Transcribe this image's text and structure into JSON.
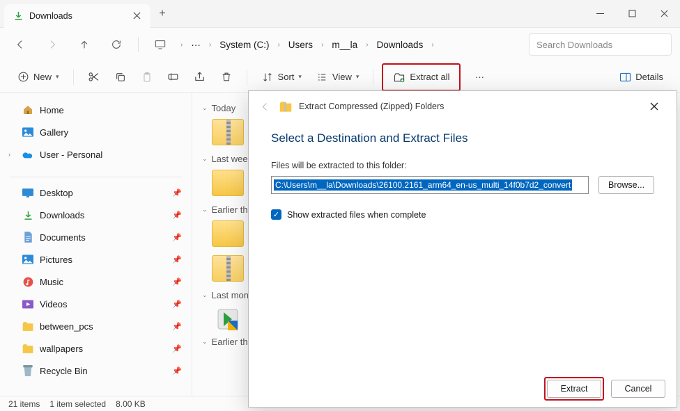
{
  "tab": {
    "title": "Downloads"
  },
  "window_buttons": {
    "min": "minimize",
    "max": "maximize",
    "close": "close"
  },
  "breadcrumbs": {
    "items": [
      "System (C:)",
      "Users",
      "m__la",
      "Downloads"
    ]
  },
  "search": {
    "placeholder": "Search Downloads"
  },
  "toolbar": {
    "new": "New",
    "sort": "Sort",
    "view": "View",
    "extract_all": "Extract all",
    "details": "Details"
  },
  "sidebar": {
    "top": [
      {
        "label": "Home"
      },
      {
        "label": "Gallery"
      },
      {
        "label": "User - Personal",
        "expandable": true
      }
    ],
    "pinned": [
      {
        "label": "Desktop"
      },
      {
        "label": "Downloads"
      },
      {
        "label": "Documents"
      },
      {
        "label": "Pictures"
      },
      {
        "label": "Music"
      },
      {
        "label": "Videos"
      },
      {
        "label": "between_pcs"
      },
      {
        "label": "wallpapers"
      },
      {
        "label": "Recycle Bin"
      }
    ]
  },
  "content": {
    "groups": [
      {
        "label": "Today"
      },
      {
        "label": "Last week"
      },
      {
        "label": "Earlier this month"
      },
      {
        "label": "Last month"
      },
      {
        "label": "Earlier this year"
      }
    ]
  },
  "status": {
    "items": "21 items",
    "selection": "1 item selected",
    "size": "8.00 KB"
  },
  "dialog": {
    "title": "Extract Compressed (Zipped) Folders",
    "heading": "Select a Destination and Extract Files",
    "path_label": "Files will be extracted to this folder:",
    "path_value": "C:\\Users\\m__la\\Downloads\\26100.2161_arm64_en-us_multi_14f0b7d2_convert",
    "browse": "Browse...",
    "checkbox_label": "Show extracted files when complete",
    "checkbox_checked": true,
    "extract": "Extract",
    "cancel": "Cancel"
  }
}
